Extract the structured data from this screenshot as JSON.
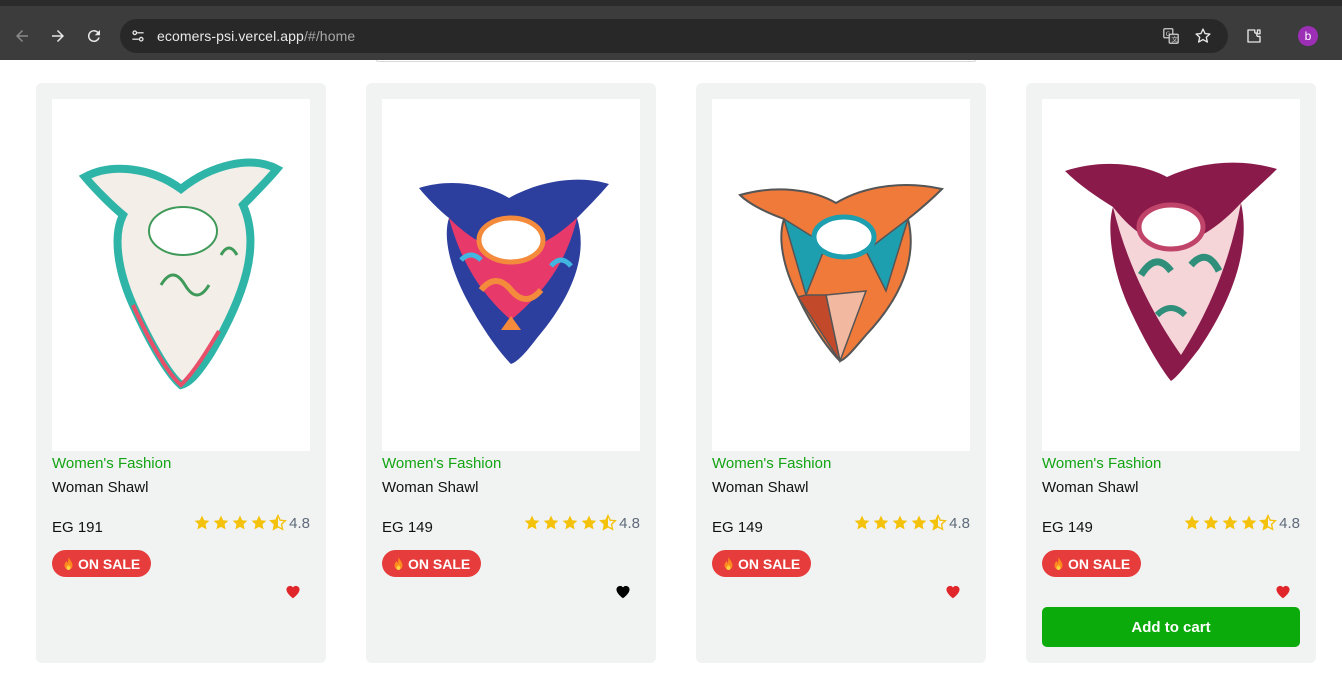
{
  "browser": {
    "url_host": "ecomers-psi.vercel.app",
    "url_path": "/#/home",
    "profile_initial": "b"
  },
  "products": [
    {
      "category": "Women's Fashion",
      "name": "Woman Shawl",
      "price": "EG 191",
      "rating": "4.8",
      "sale_label": "ON SALE",
      "wishlisted": true,
      "palette": [
        "#f3eee8",
        "#2fb5a8",
        "#e8506a",
        "#3f9a5a"
      ]
    },
    {
      "category": "Women's Fashion",
      "name": "Woman Shawl",
      "price": "EG 149",
      "rating": "4.8",
      "sale_label": "ON SALE",
      "wishlisted": false,
      "palette": [
        "#2d3f9e",
        "#e83a6a",
        "#f48a3c",
        "#40b6e0"
      ]
    },
    {
      "category": "Women's Fashion",
      "name": "Woman Shawl",
      "price": "EG 149",
      "rating": "4.8",
      "sale_label": "ON SALE",
      "wishlisted": true,
      "palette": [
        "#f07a3a",
        "#1e9fb0",
        "#f2b8a0",
        "#c24a2a"
      ]
    },
    {
      "category": "Women's Fashion",
      "name": "Woman Shawl",
      "price": "EG 149",
      "rating": "4.8",
      "sale_label": "ON SALE",
      "wishlisted": true,
      "add_to_cart_label": "Add to cart",
      "palette": [
        "#8a1a4a",
        "#f5d5d8",
        "#2f8f7a",
        "#c0446a"
      ]
    }
  ],
  "colors": {
    "category_green": "#13a513",
    "sale_red": "#e63c3c",
    "star_gold": "#f5c20b",
    "heart_red": "#e0262b",
    "cart_green": "#0aab0a"
  }
}
